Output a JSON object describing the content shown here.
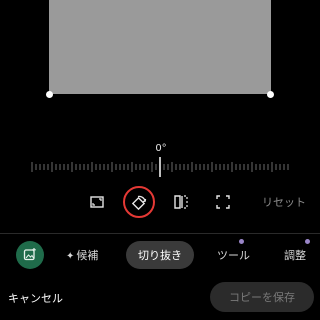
{
  "angle": {
    "value": "0°"
  },
  "tools": {
    "aspect_icon": "aspect-ratio-icon",
    "rotate_icon": "rotate-icon",
    "flip_icon": "flip-icon",
    "free_icon": "free-crop-icon",
    "reset_label": "リセット"
  },
  "tabs": {
    "suggest_label": "候補",
    "crop_label": "切り抜き",
    "tools_label": "ツール",
    "adjust_label": "調整"
  },
  "footer": {
    "cancel_label": "キャンセル",
    "save_label": "コピーを保存"
  },
  "colors": {
    "highlight_ring": "#e53935",
    "app_icon_bg": "#1f6b4a",
    "dot": "#9a86c8"
  }
}
